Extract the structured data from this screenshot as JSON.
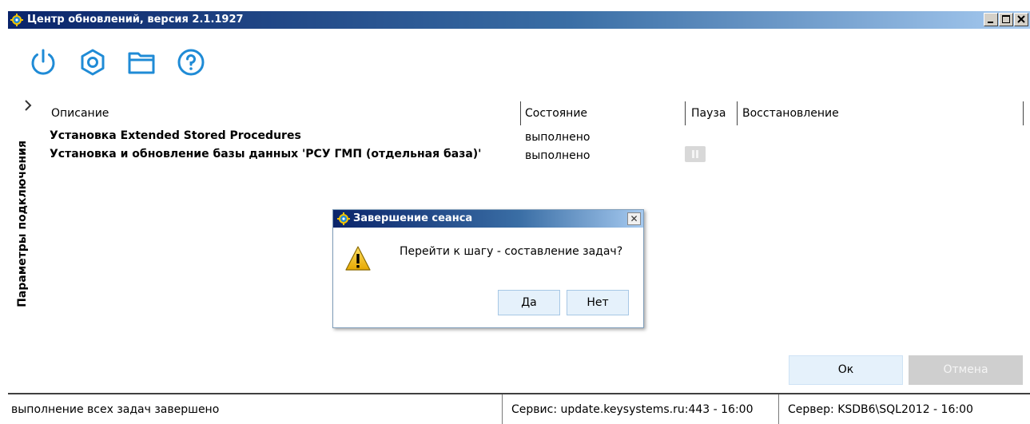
{
  "window": {
    "title": "Центр обновлений, версия 2.1.1927"
  },
  "toolbar": {
    "icons": [
      "power-icon",
      "settings-gear-icon",
      "folder-icon",
      "help-icon"
    ],
    "accent_color": "#1f8bd6"
  },
  "sidebar": {
    "label": "Параметры подключения"
  },
  "grid": {
    "columns": [
      "Описание",
      "Состояние",
      "Пауза",
      "Восстановление"
    ],
    "rows": [
      {
        "description": "Установка Extended Stored Procedures",
        "state": "выполнено"
      },
      {
        "description": "Установка и обновление базы данных 'РСУ ГМП (отдельная база)'",
        "state": "выполнено"
      }
    ]
  },
  "dialog": {
    "title": "Завершение сеанса",
    "message": "Перейти к шагу - составление задач?",
    "yes_label": "Да",
    "no_label": "Нет",
    "close_glyph": "✕"
  },
  "buttons": {
    "ok_label": "Ок",
    "cancel_label": "Отмена"
  },
  "statusbar": {
    "status_text": "выполнение всех задач завершено",
    "service_text": "Сервис:  update.keysystems.ru:443 - 16:00",
    "server_text": "Сервер:  KSDB6\\SQL2012 - 16:00"
  }
}
